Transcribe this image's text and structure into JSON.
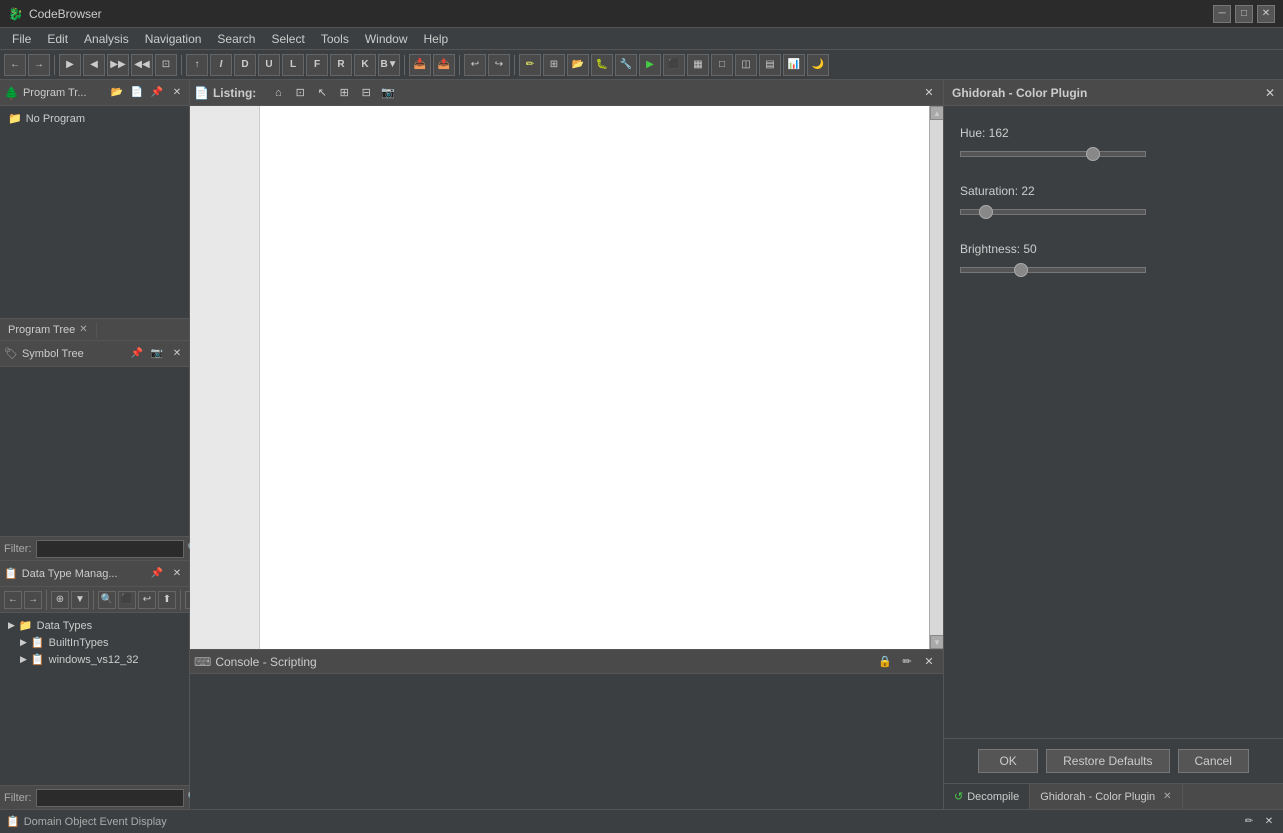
{
  "app": {
    "title": "CodeBrowser",
    "icon": "🐉"
  },
  "titlebar": {
    "minimize": "─",
    "maximize": "□",
    "close": "✕"
  },
  "menubar": {
    "items": [
      {
        "label": "File",
        "id": "file"
      },
      {
        "label": "Edit",
        "id": "edit"
      },
      {
        "label": "Analysis",
        "id": "analysis"
      },
      {
        "label": "Navigation",
        "id": "navigation"
      },
      {
        "label": "Search",
        "id": "search"
      },
      {
        "label": "Select",
        "id": "select"
      },
      {
        "label": "Tools",
        "id": "tools"
      },
      {
        "label": "Window",
        "id": "window"
      },
      {
        "label": "Help",
        "id": "help"
      }
    ]
  },
  "program_tree": {
    "title": "Program Tr...",
    "no_program": "No Program",
    "tab_label": "Program Tree",
    "tab_close": "✕"
  },
  "symbol_tree": {
    "title": "Symbol Tree",
    "filter_label": "Filter:",
    "filter_placeholder": ""
  },
  "data_type_manager": {
    "title": "Data Type Manag...",
    "root_label": "Data Types",
    "children": [
      {
        "label": "BuiltInTypes",
        "indent": 1
      },
      {
        "label": "windows_vs12_32",
        "indent": 1
      }
    ],
    "filter_label": "Filter:",
    "filter_placeholder": ""
  },
  "listing": {
    "title": "Listing:",
    "close": "✕"
  },
  "console": {
    "title": "Console - Scripting",
    "lock_icon": "🔒",
    "pen_icon": "✏",
    "close": "✕"
  },
  "color_plugin": {
    "title": "Ghidorah - Color Plugin",
    "close": "✕",
    "hue_label": "Hue: 162",
    "hue_value": 162,
    "hue_pct": 68,
    "saturation_label": "Saturation: 22",
    "saturation_value": 22,
    "saturation_pct": 10,
    "brightness_label": "Brightness: 50",
    "brightness_value": 50,
    "brightness_pct": 29,
    "ok_label": "OK",
    "restore_label": "Restore Defaults",
    "cancel_label": "Cancel"
  },
  "right_tabs": {
    "decompile_icon": "↺",
    "decompile_label": "Decompile",
    "color_plugin_label": "Ghidorah - Color Plugin",
    "close": "✕"
  },
  "domain_events": {
    "title": "Domain Object Event Display",
    "pen_icon": "✏",
    "close": "✕"
  }
}
